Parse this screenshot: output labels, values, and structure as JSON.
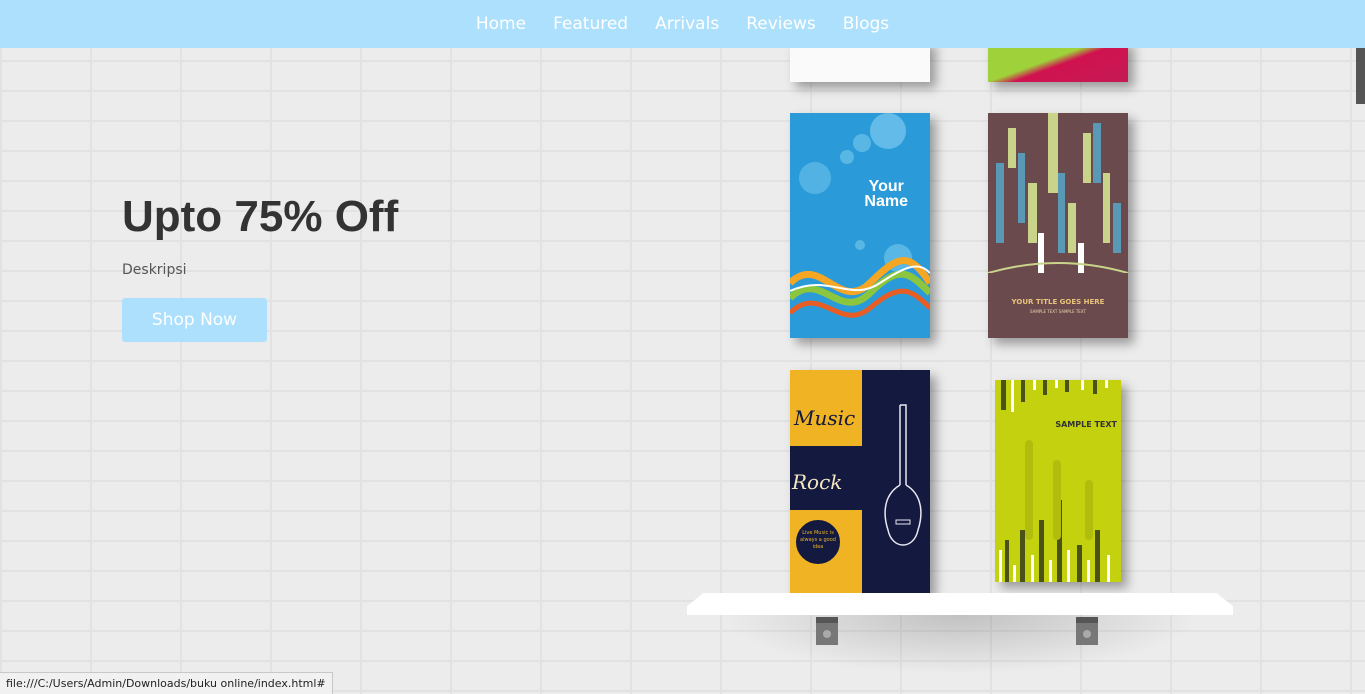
{
  "nav": {
    "items": [
      {
        "label": "Home"
      },
      {
        "label": "Featured"
      },
      {
        "label": "Arrivals"
      },
      {
        "label": "Reviews"
      },
      {
        "label": "Blogs"
      }
    ]
  },
  "hero": {
    "title": "Upto 75% Off",
    "description": "Deskripsi",
    "cta_label": "Shop Now"
  },
  "books": {
    "book_1": {
      "text_line1": "Your",
      "text_line2": "Name"
    },
    "book_2": {
      "text_title": "YOUR TITLE GOES HERE",
      "text_sub": "SAMPLE TEXT SAMPLE TEXT"
    },
    "book_3": {
      "text_music": "Music",
      "text_rock": "Rock",
      "text_badge": "Live Music is always a good idea"
    },
    "book_4": {
      "text_sample": "SAMPLE TEXT"
    }
  },
  "status_bar": {
    "url": "file:///C:/Users/Admin/Downloads/buku online/index.html#"
  },
  "colors": {
    "accent": "#ade0fc",
    "title": "#333333"
  }
}
